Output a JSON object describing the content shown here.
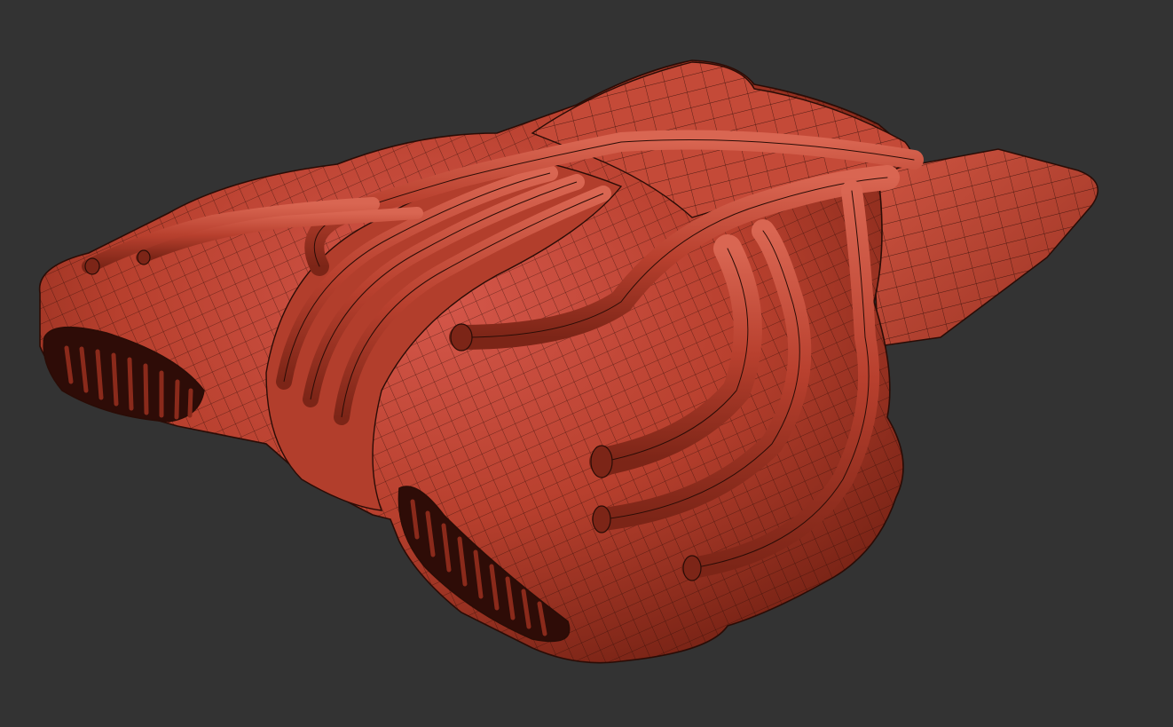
{
  "scene": {
    "background_color": "#333333",
    "model_base_color": "#b8402e",
    "model_highlight_color": "#d65a45",
    "model_shadow_color": "#6e1d12",
    "wire_color": "#2a0c06",
    "vent_color": "#3a0f08"
  }
}
